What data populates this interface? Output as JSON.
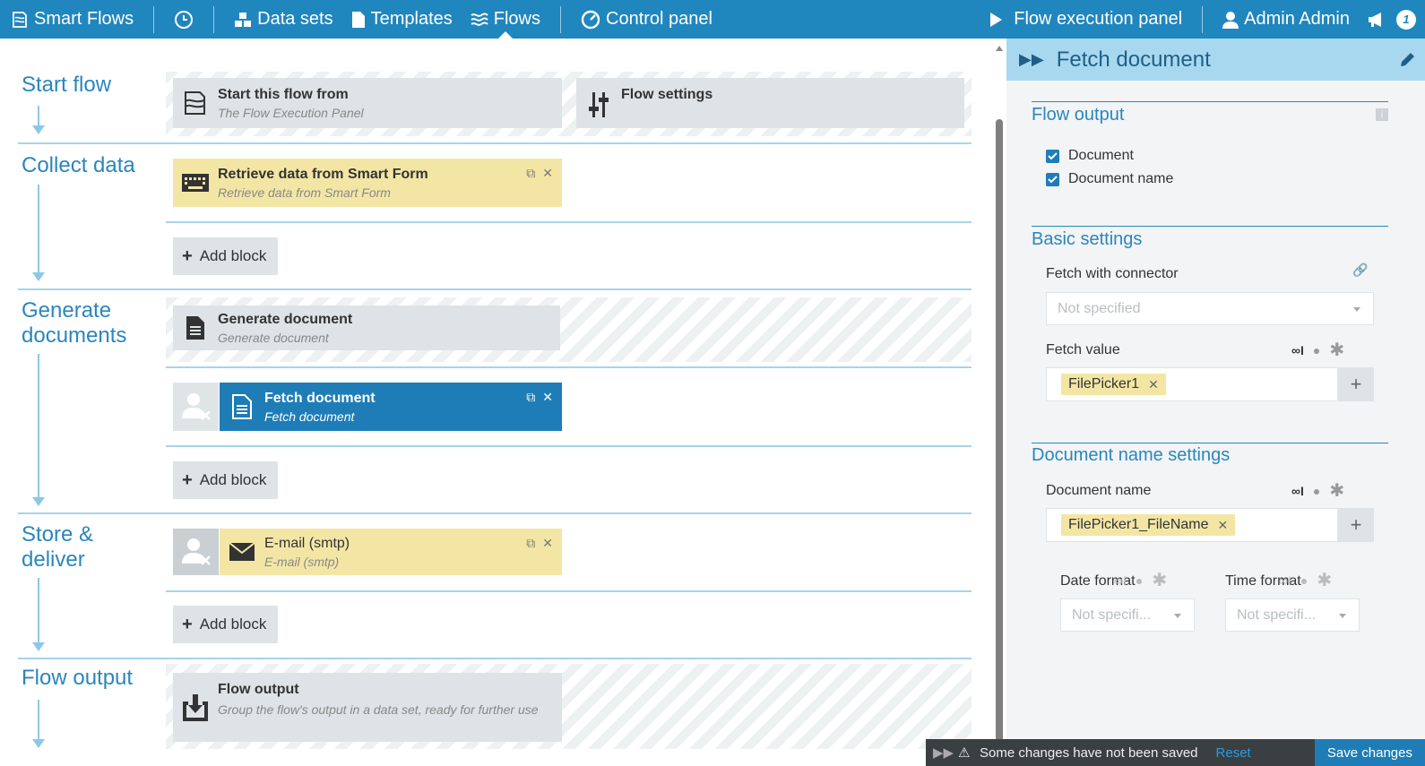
{
  "nav": {
    "brand": "Smart Flows",
    "datasets": "Data sets",
    "templates": "Templates",
    "flows": "Flows",
    "control_panel": "Control panel",
    "flow_execution_panel": "Flow execution panel",
    "user": "Admin Admin",
    "notification_count": "1"
  },
  "stages": {
    "start": "Start flow",
    "collect": "Collect data",
    "generate": "Generate documents",
    "store": "Store & deliver",
    "output": "Flow output"
  },
  "blocks": {
    "start_from_title": "Start this flow from",
    "start_from_sub": "The Flow Execution Panel",
    "flow_settings_title": "Flow settings",
    "smartform_title": "Retrieve data from Smart Form",
    "smartform_sub": "Retrieve data from Smart Form",
    "generate_title": "Generate document",
    "generate_sub": "Generate document",
    "fetch_title": "Fetch document",
    "fetch_sub": "Fetch document",
    "email_title": "E-mail (smtp)",
    "email_sub": "E-mail (smtp)",
    "output_title": "Flow output",
    "output_sub": "Group the flow's output in a data set, ready for further use",
    "add_block": "Add block"
  },
  "panel": {
    "title": "Fetch document",
    "flow_output": "Flow output",
    "chk_document": "Document",
    "chk_document_name": "Document name",
    "basic_settings": "Basic settings",
    "fetch_with_connector": "Fetch with connector",
    "connector_placeholder": "Not specified",
    "fetch_value": "Fetch value",
    "fetch_value_tag": "FilePicker1",
    "doc_name_settings": "Document name settings",
    "document_name": "Document name",
    "document_name_tag": "FilePicker1_FileName",
    "date_format": "Date format",
    "time_format": "Time format",
    "date_placeholder": "Not specifi...",
    "time_placeholder": "Not specifi..."
  },
  "savebar": {
    "message": "Some changes have not been saved",
    "reset": "Reset",
    "save": "Save changes"
  },
  "colors": {
    "primary": "#2086be",
    "yellow_block": "#f3e6a5",
    "gray_block": "#dde3e6",
    "selected_block": "#1e7db7"
  }
}
